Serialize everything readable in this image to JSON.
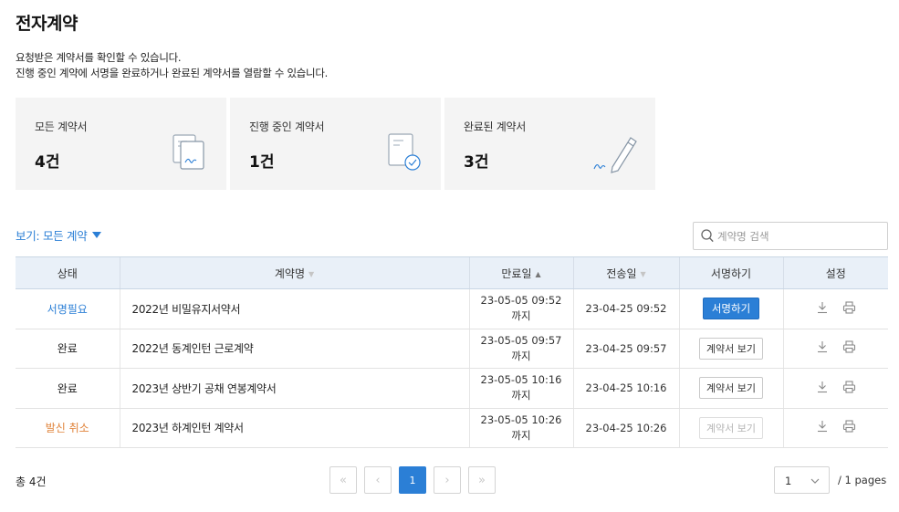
{
  "page_title": "전자계약",
  "description": {
    "line1": "요청받은 계약서를 확인할 수 있습니다.",
    "line2": "진행 중인 계약에 서명을 완료하거나 완료된 계약서를 열람할 수 있습니다."
  },
  "summary_cards": [
    {
      "label": "모든 계약서",
      "count": "4건",
      "icon": "documents-signature-icon"
    },
    {
      "label": "진행 중인 계약서",
      "count": "1건",
      "icon": "document-check-icon"
    },
    {
      "label": "완료된 계약서",
      "count": "3건",
      "icon": "pen-signature-icon"
    }
  ],
  "view_filter": {
    "label": "보기: 모든 계약"
  },
  "search": {
    "placeholder": "계약명 검색",
    "value": ""
  },
  "table": {
    "headers": {
      "status": "상태",
      "name": "계약명",
      "expiry": "만료일",
      "sent": "전송일",
      "sign": "서명하기",
      "settings": "설정"
    },
    "rows": [
      {
        "status": "서명필요",
        "status_type": "needs-signature",
        "name": "2022년 비밀유지서약서",
        "expiry_date": "23-05-05 09:52",
        "expiry_suffix": "까지",
        "sent": "23-04-25 09:52",
        "action": "서명하기",
        "action_type": "sign"
      },
      {
        "status": "완료",
        "status_type": "completed",
        "name": "2022년 동계인턴 근로계약",
        "expiry_date": "23-05-05 09:57",
        "expiry_suffix": "까지",
        "sent": "23-04-25 09:57",
        "action": "계약서 보기",
        "action_type": "view"
      },
      {
        "status": "완료",
        "status_type": "completed",
        "name": "2023년 상반기 공채 연봉계약서",
        "expiry_date": "23-05-05 10:16",
        "expiry_suffix": "까지",
        "sent": "23-04-25 10:16",
        "action": "계약서 보기",
        "action_type": "view"
      },
      {
        "status": "발신 취소",
        "status_type": "cancelled",
        "name": "2023년 하계인턴 계약서",
        "expiry_date": "23-05-05 10:26",
        "expiry_suffix": "까지",
        "sent": "23-04-25 10:26",
        "action": "계약서 보기",
        "action_type": "view-disabled"
      }
    ]
  },
  "footer": {
    "total": "총 4건",
    "pagination": {
      "first": "«",
      "prev": "‹",
      "current": "1",
      "next": "›",
      "last": "»"
    },
    "page_select": {
      "value": "1"
    },
    "pages_label": "/ 1 pages"
  },
  "colors": {
    "accent": "#2b7fd6",
    "cancelled": "#e0833a",
    "card_bg": "#f4f4f4",
    "header_bg": "#e9f0f8"
  }
}
